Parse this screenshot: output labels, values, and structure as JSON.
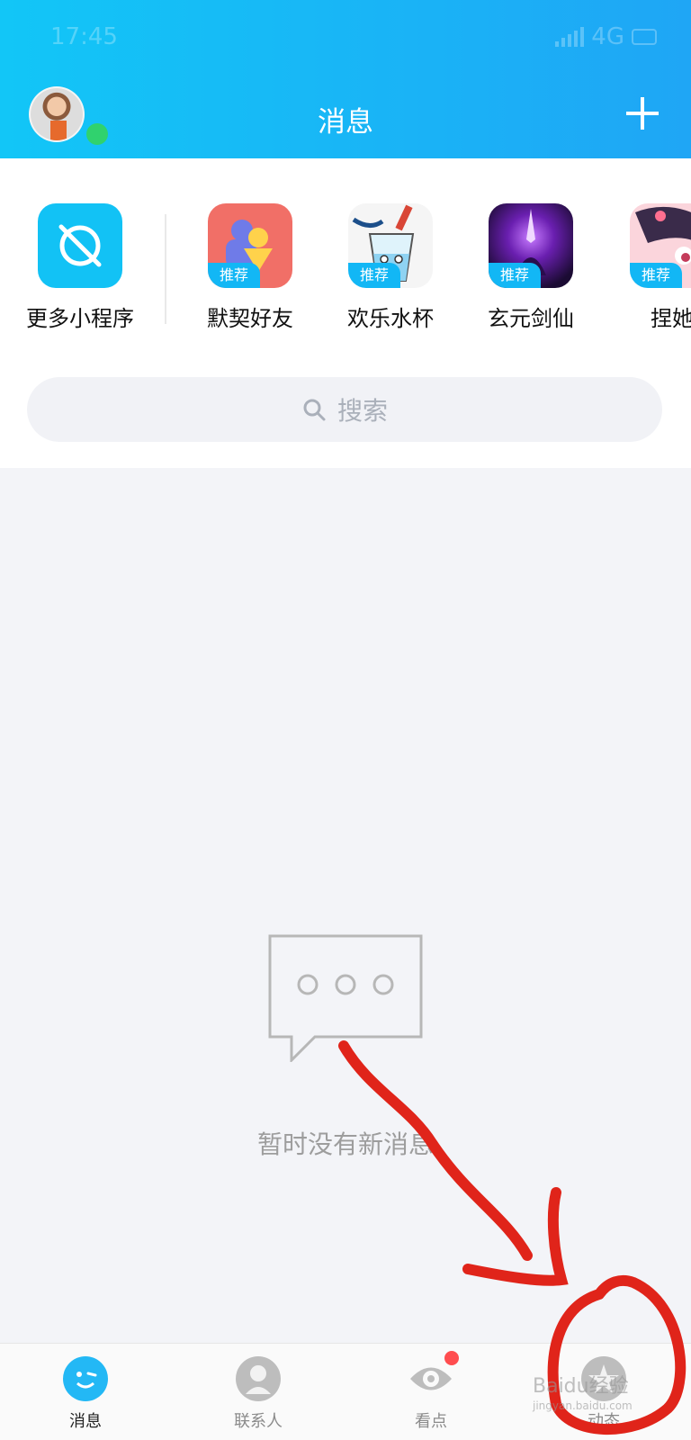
{
  "status": {
    "time": "17:45",
    "network": "4G"
  },
  "header": {
    "title": "消息"
  },
  "mini_programs": [
    {
      "label": "更多小程序",
      "tag": ""
    },
    {
      "label": "默契好友",
      "tag": "推荐"
    },
    {
      "label": "欢乐水杯",
      "tag": "推荐"
    },
    {
      "label": "玄元剑仙",
      "tag": "推荐"
    },
    {
      "label": "捏她",
      "tag": "推荐"
    }
  ],
  "search": {
    "placeholder": "搜索"
  },
  "empty": {
    "text": "暂时没有新消息"
  },
  "tabs": [
    {
      "label": "消息",
      "icon": "chat-face-icon",
      "active": true
    },
    {
      "label": "联系人",
      "icon": "person-icon",
      "active": false
    },
    {
      "label": "看点",
      "icon": "eye-icon",
      "active": false,
      "badge": true
    },
    {
      "label": "动态",
      "icon": "star-icon",
      "active": false
    }
  ],
  "watermark": {
    "brand": "Baidu经验",
    "url": "jingyan.baidu.com"
  },
  "colors": {
    "header_start": "#12c6f7",
    "header_end": "#1fa6f5",
    "accent": "#12b7f5",
    "annotation": "#e0241a"
  }
}
